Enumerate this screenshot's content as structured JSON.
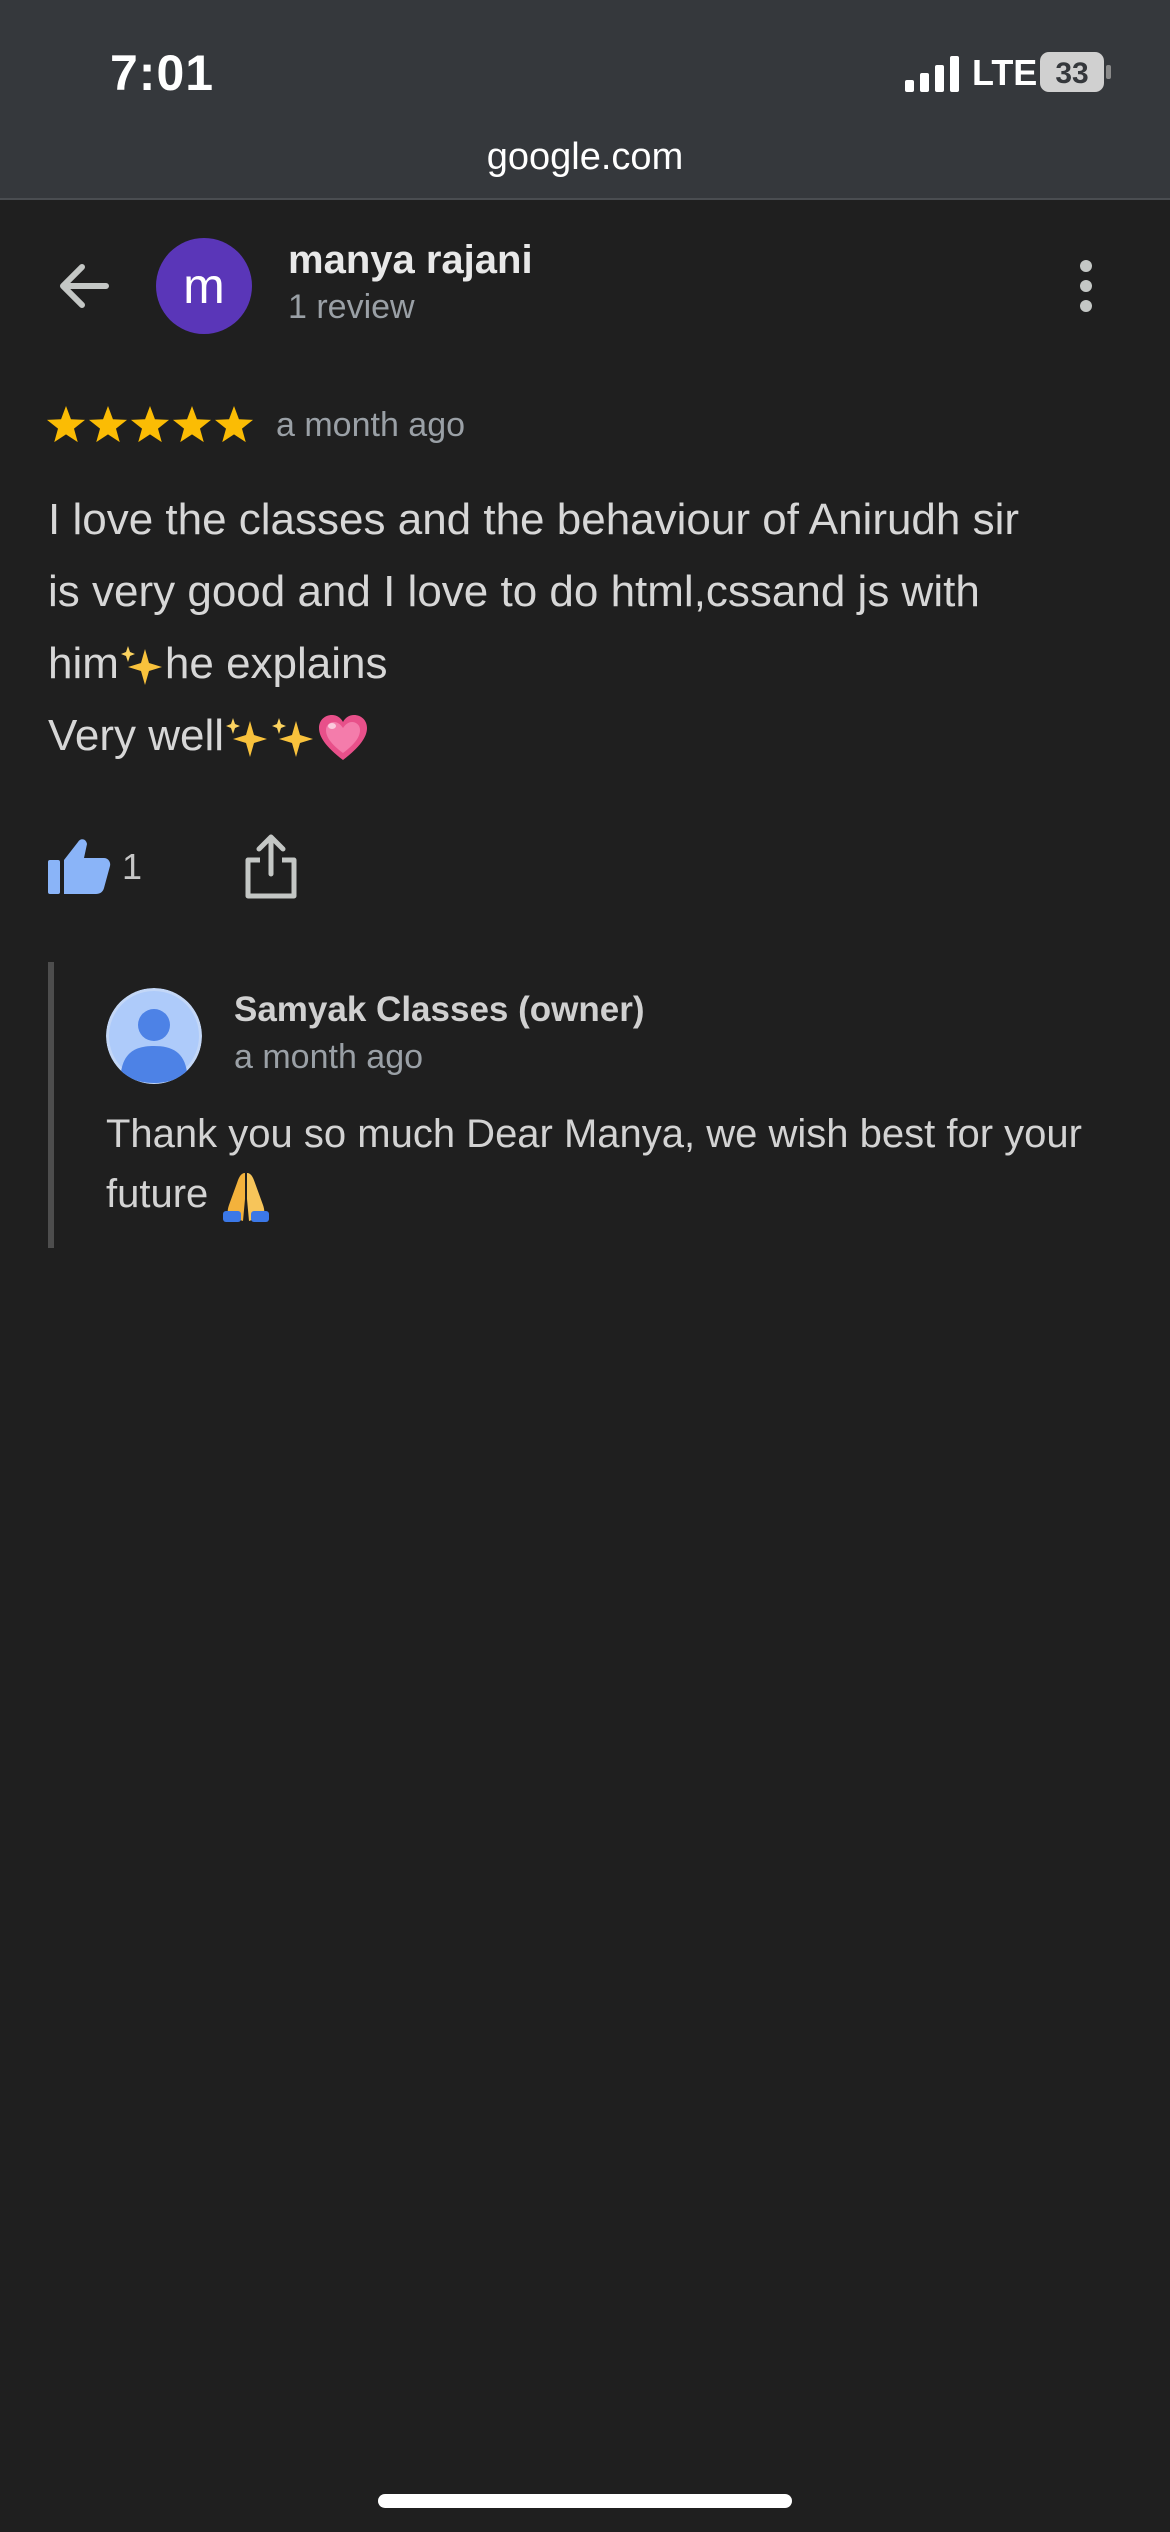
{
  "status_bar": {
    "time": "7:01",
    "network": "LTE",
    "battery": "33"
  },
  "browser": {
    "domain": "google.com"
  },
  "reviewer": {
    "avatar_letter": "m",
    "name": "manya rajani",
    "review_count": "1 review"
  },
  "review": {
    "rating": 5,
    "time_ago": "a month ago",
    "lines": [
      "I love the classes and the behaviour of Anirudh sir",
      "is very good and I love to do html,cssand js with",
      "him",
      "he explains",
      "Very well"
    ],
    "like_count": "1"
  },
  "owner_reply": {
    "name": "Samyak Classes (owner)",
    "time_ago": "a month ago",
    "text": "Thank you so much Dear Manya, we wish best for your future"
  },
  "icons": {
    "back": "arrow-left-icon",
    "more": "more-vert-icon",
    "star": "star-icon",
    "like": "thumbs-up-icon",
    "share": "share-icon",
    "sparkles": "sparkles-emoji",
    "heart": "pink-heart-emoji",
    "pray": "folded-hands-emoji"
  },
  "colors": {
    "background": "#1f1f1f",
    "status_bar": "#35383c",
    "avatar": "#5a36b8",
    "star": "#fbbc04",
    "like": "#8ab4f8",
    "muted_text": "#9aa0a6"
  }
}
